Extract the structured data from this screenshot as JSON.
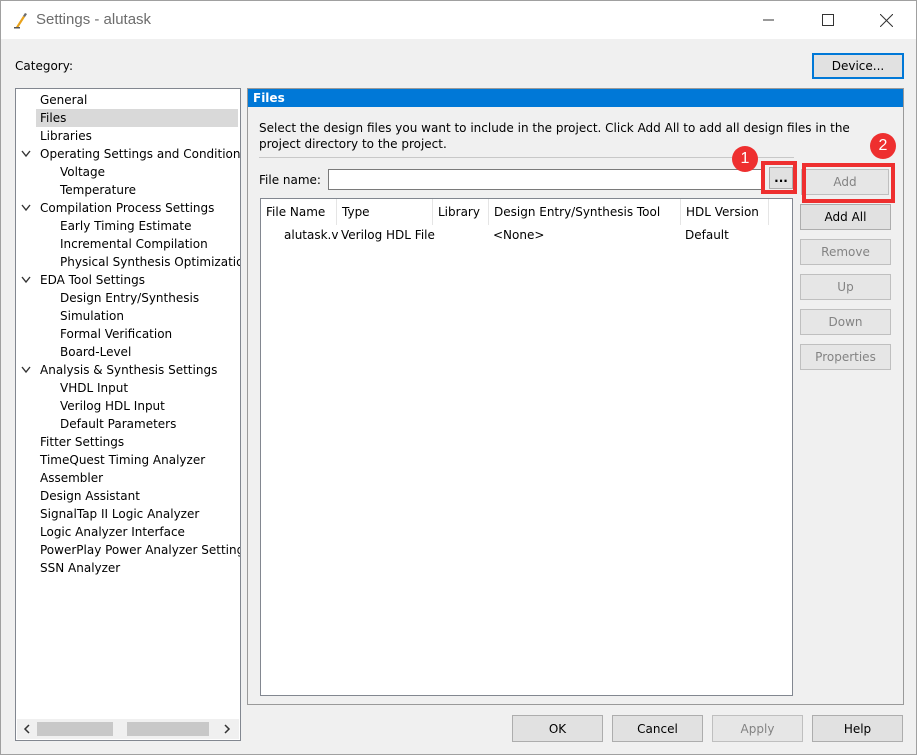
{
  "window": {
    "title": "Settings - alutask"
  },
  "category_label": "Category:",
  "device_button": "Device...",
  "tree": {
    "items": [
      {
        "label": "General",
        "level": 0,
        "expandable": false,
        "selected": false
      },
      {
        "label": "Files",
        "level": 0,
        "expandable": false,
        "selected": true
      },
      {
        "label": "Libraries",
        "level": 0,
        "expandable": false,
        "selected": false
      },
      {
        "label": "Operating Settings and Conditions",
        "level": 0,
        "expandable": true,
        "selected": false
      },
      {
        "label": "Voltage",
        "level": 1,
        "expandable": false,
        "selected": false
      },
      {
        "label": "Temperature",
        "level": 1,
        "expandable": false,
        "selected": false
      },
      {
        "label": "Compilation Process Settings",
        "level": 0,
        "expandable": true,
        "selected": false
      },
      {
        "label": "Early Timing Estimate",
        "level": 1,
        "expandable": false,
        "selected": false
      },
      {
        "label": "Incremental Compilation",
        "level": 1,
        "expandable": false,
        "selected": false
      },
      {
        "label": "Physical Synthesis Optimization",
        "level": 1,
        "expandable": false,
        "selected": false
      },
      {
        "label": "EDA Tool Settings",
        "level": 0,
        "expandable": true,
        "selected": false
      },
      {
        "label": "Design Entry/Synthesis",
        "level": 1,
        "expandable": false,
        "selected": false
      },
      {
        "label": "Simulation",
        "level": 1,
        "expandable": false,
        "selected": false
      },
      {
        "label": "Formal Verification",
        "level": 1,
        "expandable": false,
        "selected": false
      },
      {
        "label": "Board-Level",
        "level": 1,
        "expandable": false,
        "selected": false
      },
      {
        "label": "Analysis & Synthesis Settings",
        "level": 0,
        "expandable": true,
        "selected": false
      },
      {
        "label": "VHDL Input",
        "level": 1,
        "expandable": false,
        "selected": false
      },
      {
        "label": "Verilog HDL Input",
        "level": 1,
        "expandable": false,
        "selected": false
      },
      {
        "label": "Default Parameters",
        "level": 1,
        "expandable": false,
        "selected": false
      },
      {
        "label": "Fitter Settings",
        "level": 0,
        "expandable": false,
        "selected": false
      },
      {
        "label": "TimeQuest Timing Analyzer",
        "level": 0,
        "expandable": false,
        "selected": false
      },
      {
        "label": "Assembler",
        "level": 0,
        "expandable": false,
        "selected": false
      },
      {
        "label": "Design Assistant",
        "level": 0,
        "expandable": false,
        "selected": false
      },
      {
        "label": "SignalTap II Logic Analyzer",
        "level": 0,
        "expandable": false,
        "selected": false
      },
      {
        "label": "Logic Analyzer Interface",
        "level": 0,
        "expandable": false,
        "selected": false
      },
      {
        "label": "PowerPlay Power Analyzer Settings",
        "level": 0,
        "expandable": false,
        "selected": false
      },
      {
        "label": "SSN Analyzer",
        "level": 0,
        "expandable": false,
        "selected": false
      }
    ]
  },
  "panel": {
    "header": "Files",
    "description": "Select the design files you want to include in the project. Click Add All to add all design files in the project directory to the project.",
    "file_name_label": "File name:",
    "file_name_value": "",
    "browse_label": "...",
    "columns": [
      "File Name",
      "Type",
      "Library",
      "Design Entry/Synthesis Tool",
      "HDL Version"
    ],
    "rows": [
      {
        "file_name": "alutask.v",
        "type": "Verilog HDL File",
        "library": "",
        "tool": "<None>",
        "hdl_version": "Default"
      }
    ]
  },
  "side_buttons": {
    "add": "Add",
    "add_all": "Add All",
    "remove": "Remove",
    "up": "Up",
    "down": "Down",
    "properties": "Properties"
  },
  "bottom_buttons": {
    "ok": "OK",
    "cancel": "Cancel",
    "apply": "Apply",
    "help": "Help"
  },
  "annotations": {
    "marker_1": "1",
    "marker_2": "2"
  },
  "colors": {
    "accent": "#0078d7",
    "annotation": "#ee2f2f",
    "selection": "#d9d9d9"
  }
}
